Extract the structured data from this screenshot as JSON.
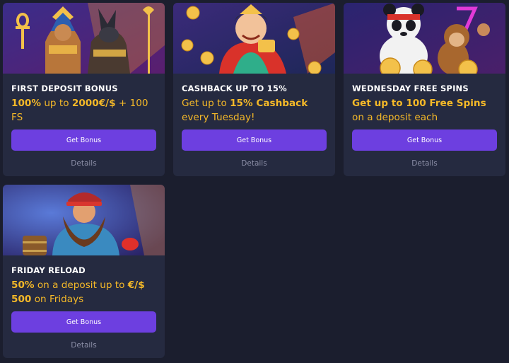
{
  "colors": {
    "page_background": "#1b1e2e",
    "card_background": "#252a40",
    "accent_button": "#6d3fe0",
    "highlight_text": "#f5b928",
    "muted_text": "#8d90a8"
  },
  "promos": [
    {
      "title": "FIRST DEPOSIT BONUS",
      "desc_parts": [
        "100%",
        " up to ",
        "2000€/$",
        " + 100 FS"
      ],
      "button_label": "Get Bonus",
      "details_label": "Details",
      "art": "egyptian-gods-art"
    },
    {
      "title": "CASHBACK UP TO 15%",
      "desc_parts": [
        "Get up to ",
        "15% Cashback",
        " every Tuesday!"
      ],
      "button_label": "Get Bonus",
      "details_label": "Details",
      "art": "fortune-god-art"
    },
    {
      "title": "WEDNESDAY FREE SPINS",
      "desc_parts": [
        "Get up to 100 Free Spins",
        " on a deposit each Wednesday."
      ],
      "button_label": "Get Bonus",
      "details_label": "Details",
      "art": "panda-monkey-art"
    },
    {
      "title": "FRIDAY RELOAD",
      "desc_parts": [
        "50%",
        " on a deposit up to ",
        " €/$ 500",
        " on Fridays"
      ],
      "button_label": "Get Bonus",
      "details_label": "Details",
      "art": "dwarf-pirate-art"
    }
  ]
}
